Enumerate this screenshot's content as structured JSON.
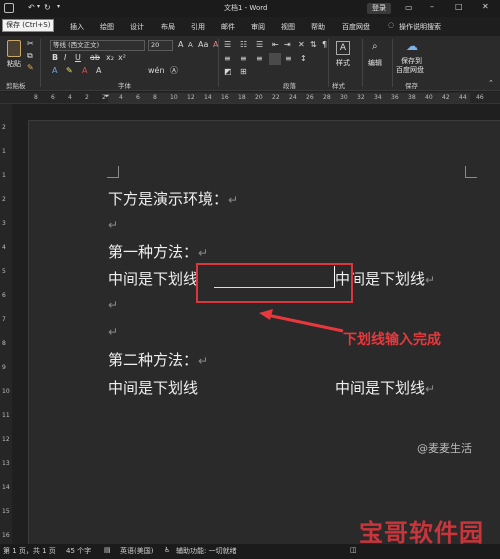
{
  "titlebar": {
    "save_tooltip": "保存 (Ctrl+S)",
    "doc_title": "文档1 - Word",
    "login_label": "登录"
  },
  "tabs": [
    {
      "label": "插入"
    },
    {
      "label": "绘图"
    },
    {
      "label": "设计"
    },
    {
      "label": "布局"
    },
    {
      "label": "引用"
    },
    {
      "label": "邮件"
    },
    {
      "label": "审阅"
    },
    {
      "label": "视图"
    },
    {
      "label": "帮助"
    },
    {
      "label": "百度网盘"
    }
  ],
  "tell_me": "操作说明搜索",
  "ribbon": {
    "paste_label": "粘贴",
    "clipboard_label": "剪贴板",
    "font_name": "等线 (西文正文)",
    "font_size": "20",
    "font_group_label": "字体",
    "paragraph_label": "段落",
    "styles_label": "样式",
    "styles_group_label": "样式",
    "edit_label": "编辑",
    "save_to_label": "保存到",
    "baidu_label": "百度网盘",
    "save_group_label": "保存"
  },
  "ruler_numbers": [
    "8",
    "6",
    "4",
    "2",
    "2",
    "4",
    "6",
    "8",
    "10",
    "12",
    "14",
    "16",
    "18",
    "20",
    "22",
    "24",
    "26",
    "28",
    "30",
    "32",
    "34",
    "36",
    "38",
    "40",
    "42",
    "44",
    "46"
  ],
  "vruler_numbers": [
    "2",
    "1",
    "1",
    "2",
    "3",
    "4",
    "5",
    "6",
    "7",
    "8",
    "9",
    "10",
    "11",
    "12",
    "13",
    "14",
    "15",
    "16"
  ],
  "document": {
    "line1": "下方是演示环境：",
    "method1": "第一种方法：",
    "m1_left": "中间是下划线",
    "m1_right": "中间是下划线",
    "method2": "第二种方法：",
    "m2_left": "中间是下划线",
    "m2_right": "中间是下划线",
    "para_mark": "↵"
  },
  "annotation": {
    "text": "下划线输入完成",
    "color": "#e8383d"
  },
  "status": {
    "page": "第 1 页，共 1 页",
    "words": "45 个字",
    "language": "英语(美国)",
    "accessibility": "辅助功能: 一切就绪"
  },
  "watermark": {
    "text": "宝哥软件园",
    "sub": "@麦麦生活"
  }
}
